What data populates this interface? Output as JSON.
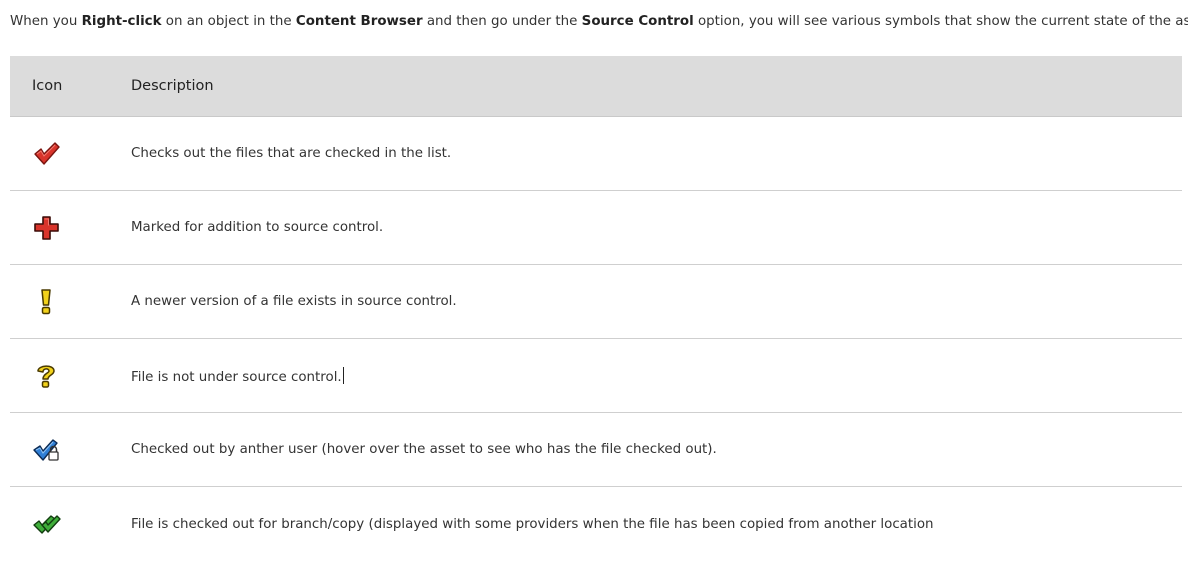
{
  "intro": {
    "part1": "When you ",
    "bold1": "Right-click",
    "part2": " on an object in the ",
    "bold2": "Content Browser",
    "part3": " and then go under the ",
    "bold3": "Source Control",
    "part4": " option, you will see various symbols that show the current state of the assets."
  },
  "table": {
    "header_icon": "Icon",
    "header_description": "Description",
    "rows": [
      {
        "icon": "red-checkmark-icon",
        "description": "Checks out the files that are checked in the list."
      },
      {
        "icon": "red-plus-icon",
        "description": "Marked for addition to source control."
      },
      {
        "icon": "yellow-exclamation-icon",
        "description": "A newer version of a file exists in source control."
      },
      {
        "icon": "yellow-question-icon",
        "description": "File is not under source control."
      },
      {
        "icon": "blue-checkmark-lock-icon",
        "description": "Checked out by anther user (hover over the asset to see who has the file checked out)."
      },
      {
        "icon": "green-double-checkmark-icon",
        "description": "File is checked out for branch/copy (displayed with some providers when the file has been copied from another location"
      }
    ]
  },
  "colors": {
    "header_bg": "#dcdcdc",
    "red": "#d9342b",
    "yellow": "#f2d21b",
    "blue": "#2f7fd6",
    "green": "#3fae3a"
  }
}
